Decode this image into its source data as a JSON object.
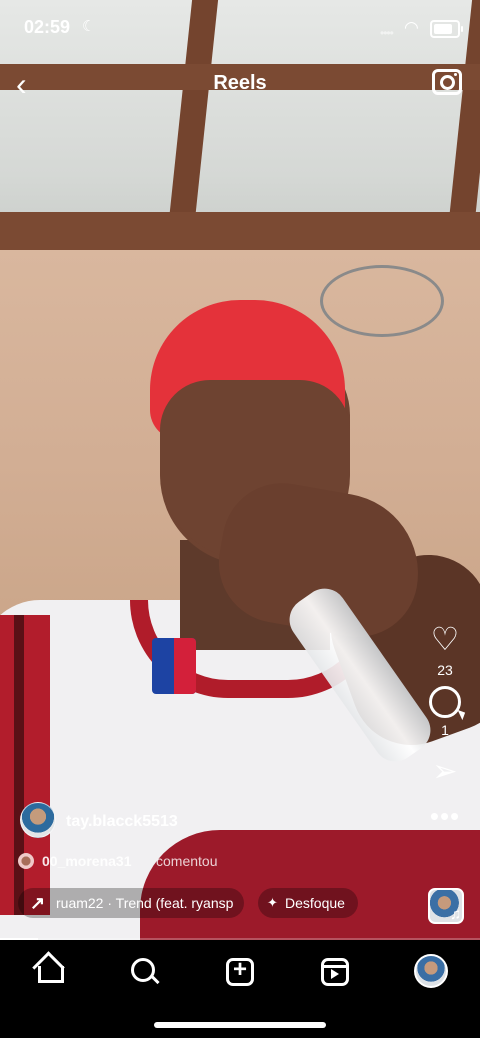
{
  "status_bar": {
    "time": "02:59",
    "moon_glyph": "☾",
    "signal_glyph": "••••",
    "wifi_glyph": "◠"
  },
  "header": {
    "back_glyph": "‹",
    "title": "Reels",
    "camera_icon": "camera-icon"
  },
  "actions": {
    "like_glyph": "♡",
    "like_count": "23",
    "comment_count": "1",
    "send_glyph": "➢",
    "more_glyph": "•••"
  },
  "post": {
    "username": "tay.blacck5513",
    "comment_user": "00_morena31",
    "comment_text": "comentou",
    "audio_arrow": "↗",
    "audio": "ruam22 · Trend (feat. ryansp",
    "effect_glyph": "✦",
    "effect": "Desfoque",
    "music_note": "♫"
  },
  "progress": {
    "fraction": 0.08
  },
  "tab_bar": {
    "tabs": [
      "home",
      "search",
      "create",
      "reels",
      "profile"
    ],
    "active": "reels"
  },
  "colors": {
    "background": "#000000",
    "text": "#ffffff"
  }
}
